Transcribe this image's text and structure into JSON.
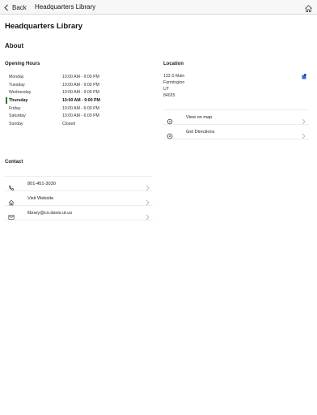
{
  "nav": {
    "back_label": "Back",
    "title": "Headquarters Library"
  },
  "page": {
    "title": "Headquarters Library"
  },
  "about": {
    "heading": "About",
    "hours": {
      "heading": "Opening Hours",
      "rows": [
        {
          "day": "Monday",
          "time": "10:00 AM - 9:00 PM",
          "today": false
        },
        {
          "day": "Tuesday",
          "time": "10:00 AM - 9:00 PM",
          "today": false
        },
        {
          "day": "Wednesday",
          "time": "10:00 AM - 9:00 PM",
          "today": false
        },
        {
          "day": "Thursday",
          "time": "10:00 AM - 9:00 PM",
          "today": true
        },
        {
          "day": "Friday",
          "time": "10:00 AM - 6:00 PM",
          "today": false
        },
        {
          "day": "Saturday",
          "time": "10:00 AM - 6:00 PM",
          "today": false
        },
        {
          "day": "Sunday",
          "time": "Closed",
          "today": false
        }
      ]
    },
    "location": {
      "heading": "Location",
      "address_lines": [
        "133 S Main",
        "Farmington",
        "UT",
        "84025"
      ],
      "actions": [
        {
          "label": "View on map",
          "icon": "map-icon"
        },
        {
          "label": "Get Directions",
          "icon": "directions-icon"
        }
      ]
    },
    "contact": {
      "heading": "Contact",
      "items": [
        {
          "label": "801-451-3030",
          "icon": "phone-icon"
        },
        {
          "label": "Visit Website",
          "icon": "home-icon"
        },
        {
          "label": "library@co.davis.ut.us",
          "icon": "mail-icon"
        }
      ]
    }
  },
  "colors": {
    "today_marker": "#1f7a2e",
    "pin": "#2a6fd6"
  }
}
